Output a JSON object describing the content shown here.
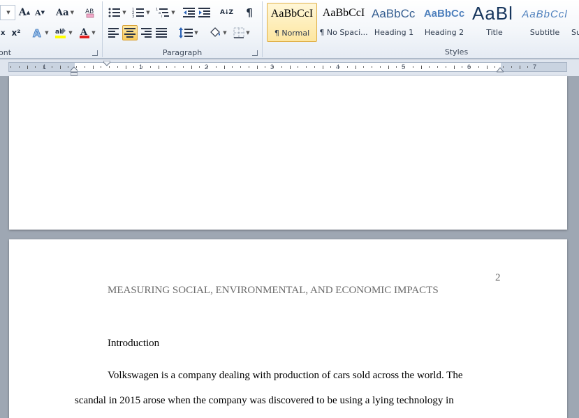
{
  "ribbon": {
    "font_group": {
      "label": "ont",
      "grow_label": "A",
      "shrink_label": "A",
      "case_label": "Aa",
      "superscript": "x²",
      "fontcolor_letter": "A"
    },
    "paragraph_group": {
      "label": "Paragraph",
      "pilcrow": "¶",
      "sort_label": "A↓Z"
    },
    "styles_group": {
      "label": "Styles",
      "items": [
        {
          "sample": "AaBbCcI",
          "name": "¶ Normal"
        },
        {
          "sample": "AaBbCcI",
          "name": "¶ No Spaci..."
        },
        {
          "sample": "AaBbCc",
          "name": "Heading 1"
        },
        {
          "sample": "AaBbCc",
          "name": "Heading 2"
        },
        {
          "sample": "AaBl",
          "name": "Title"
        },
        {
          "sample": "AaBbCcl",
          "name": "Subtitle"
        },
        {
          "sample": "",
          "name": "Su"
        }
      ]
    },
    "colors": {
      "highlight": "#ffff00",
      "font_color": "#e02020",
      "heading_blue": "#365f91",
      "heading2_blue": "#4f81bd"
    }
  },
  "ruler": {
    "numbers": [
      "1",
      "1",
      "2",
      "3",
      "4",
      "5",
      "6",
      "7"
    ]
  },
  "document": {
    "page_number": "2",
    "running_head": "MEASURING SOCIAL, ENVIRONMENTAL, AND ECONOMIC IMPACTS",
    "section_heading": "Introduction",
    "paragraph_line1": "Volkswagen is a company dealing with production of cars sold across the world. The",
    "paragraph_line2": "scandal in 2015 arose when the company was discovered to be using a lying technology in"
  }
}
